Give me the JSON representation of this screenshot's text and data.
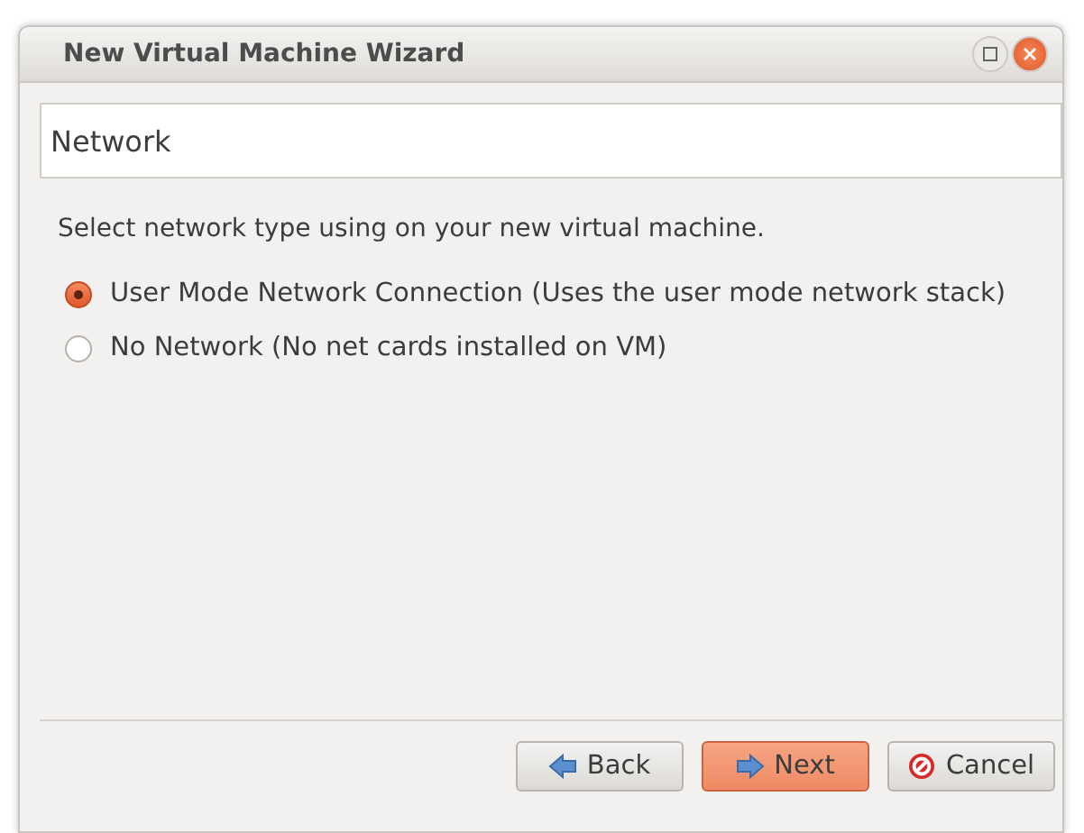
{
  "window": {
    "title": "New Virtual Machine Wizard"
  },
  "header": "Network",
  "prompt": "Select network type using on your new virtual machine.",
  "options": [
    {
      "label": "User Mode Network Connection (Uses the user mode network stack)",
      "selected": true
    },
    {
      "label": "No Network (No net cards installed on VM)",
      "selected": false
    }
  ],
  "buttons": [
    {
      "kind": "back",
      "label": "Back",
      "focused": false
    },
    {
      "kind": "next",
      "label": "Next",
      "focused": true
    },
    {
      "kind": "cancel",
      "label": "Cancel",
      "focused": false
    }
  ]
}
